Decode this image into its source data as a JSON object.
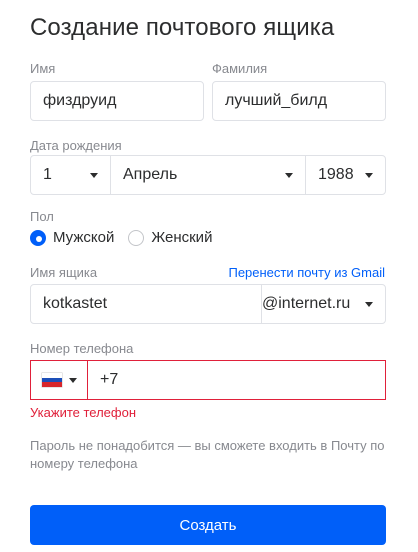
{
  "title": "Создание почтового ящика",
  "first_name": {
    "label": "Имя",
    "value": "физдруид"
  },
  "last_name": {
    "label": "Фамилия",
    "value": "лучший_билд"
  },
  "birth_date": {
    "label": "Дата рождения",
    "day": "1",
    "month": "Апрель",
    "year": "1988"
  },
  "gender": {
    "label": "Пол",
    "options": [
      "Мужской",
      "Женский"
    ],
    "selected": "Мужской"
  },
  "mailbox": {
    "label": "Имя ящика",
    "value": "kotkastet",
    "domain": "@internet.ru",
    "import_link": "Перенести почту из Gmail"
  },
  "phone": {
    "label": "Номер телефона",
    "prefix": "+7",
    "country_icon": "russia-flag-icon",
    "error": "Укажите телефон"
  },
  "hint": "Пароль не понадобится — вы сможете входить в Почту по номеру телефона",
  "submit_label": "Создать",
  "colors": {
    "accent": "#005ff9",
    "error": "#e0203a",
    "label": "#87898f",
    "border": "#dfe1e6"
  }
}
